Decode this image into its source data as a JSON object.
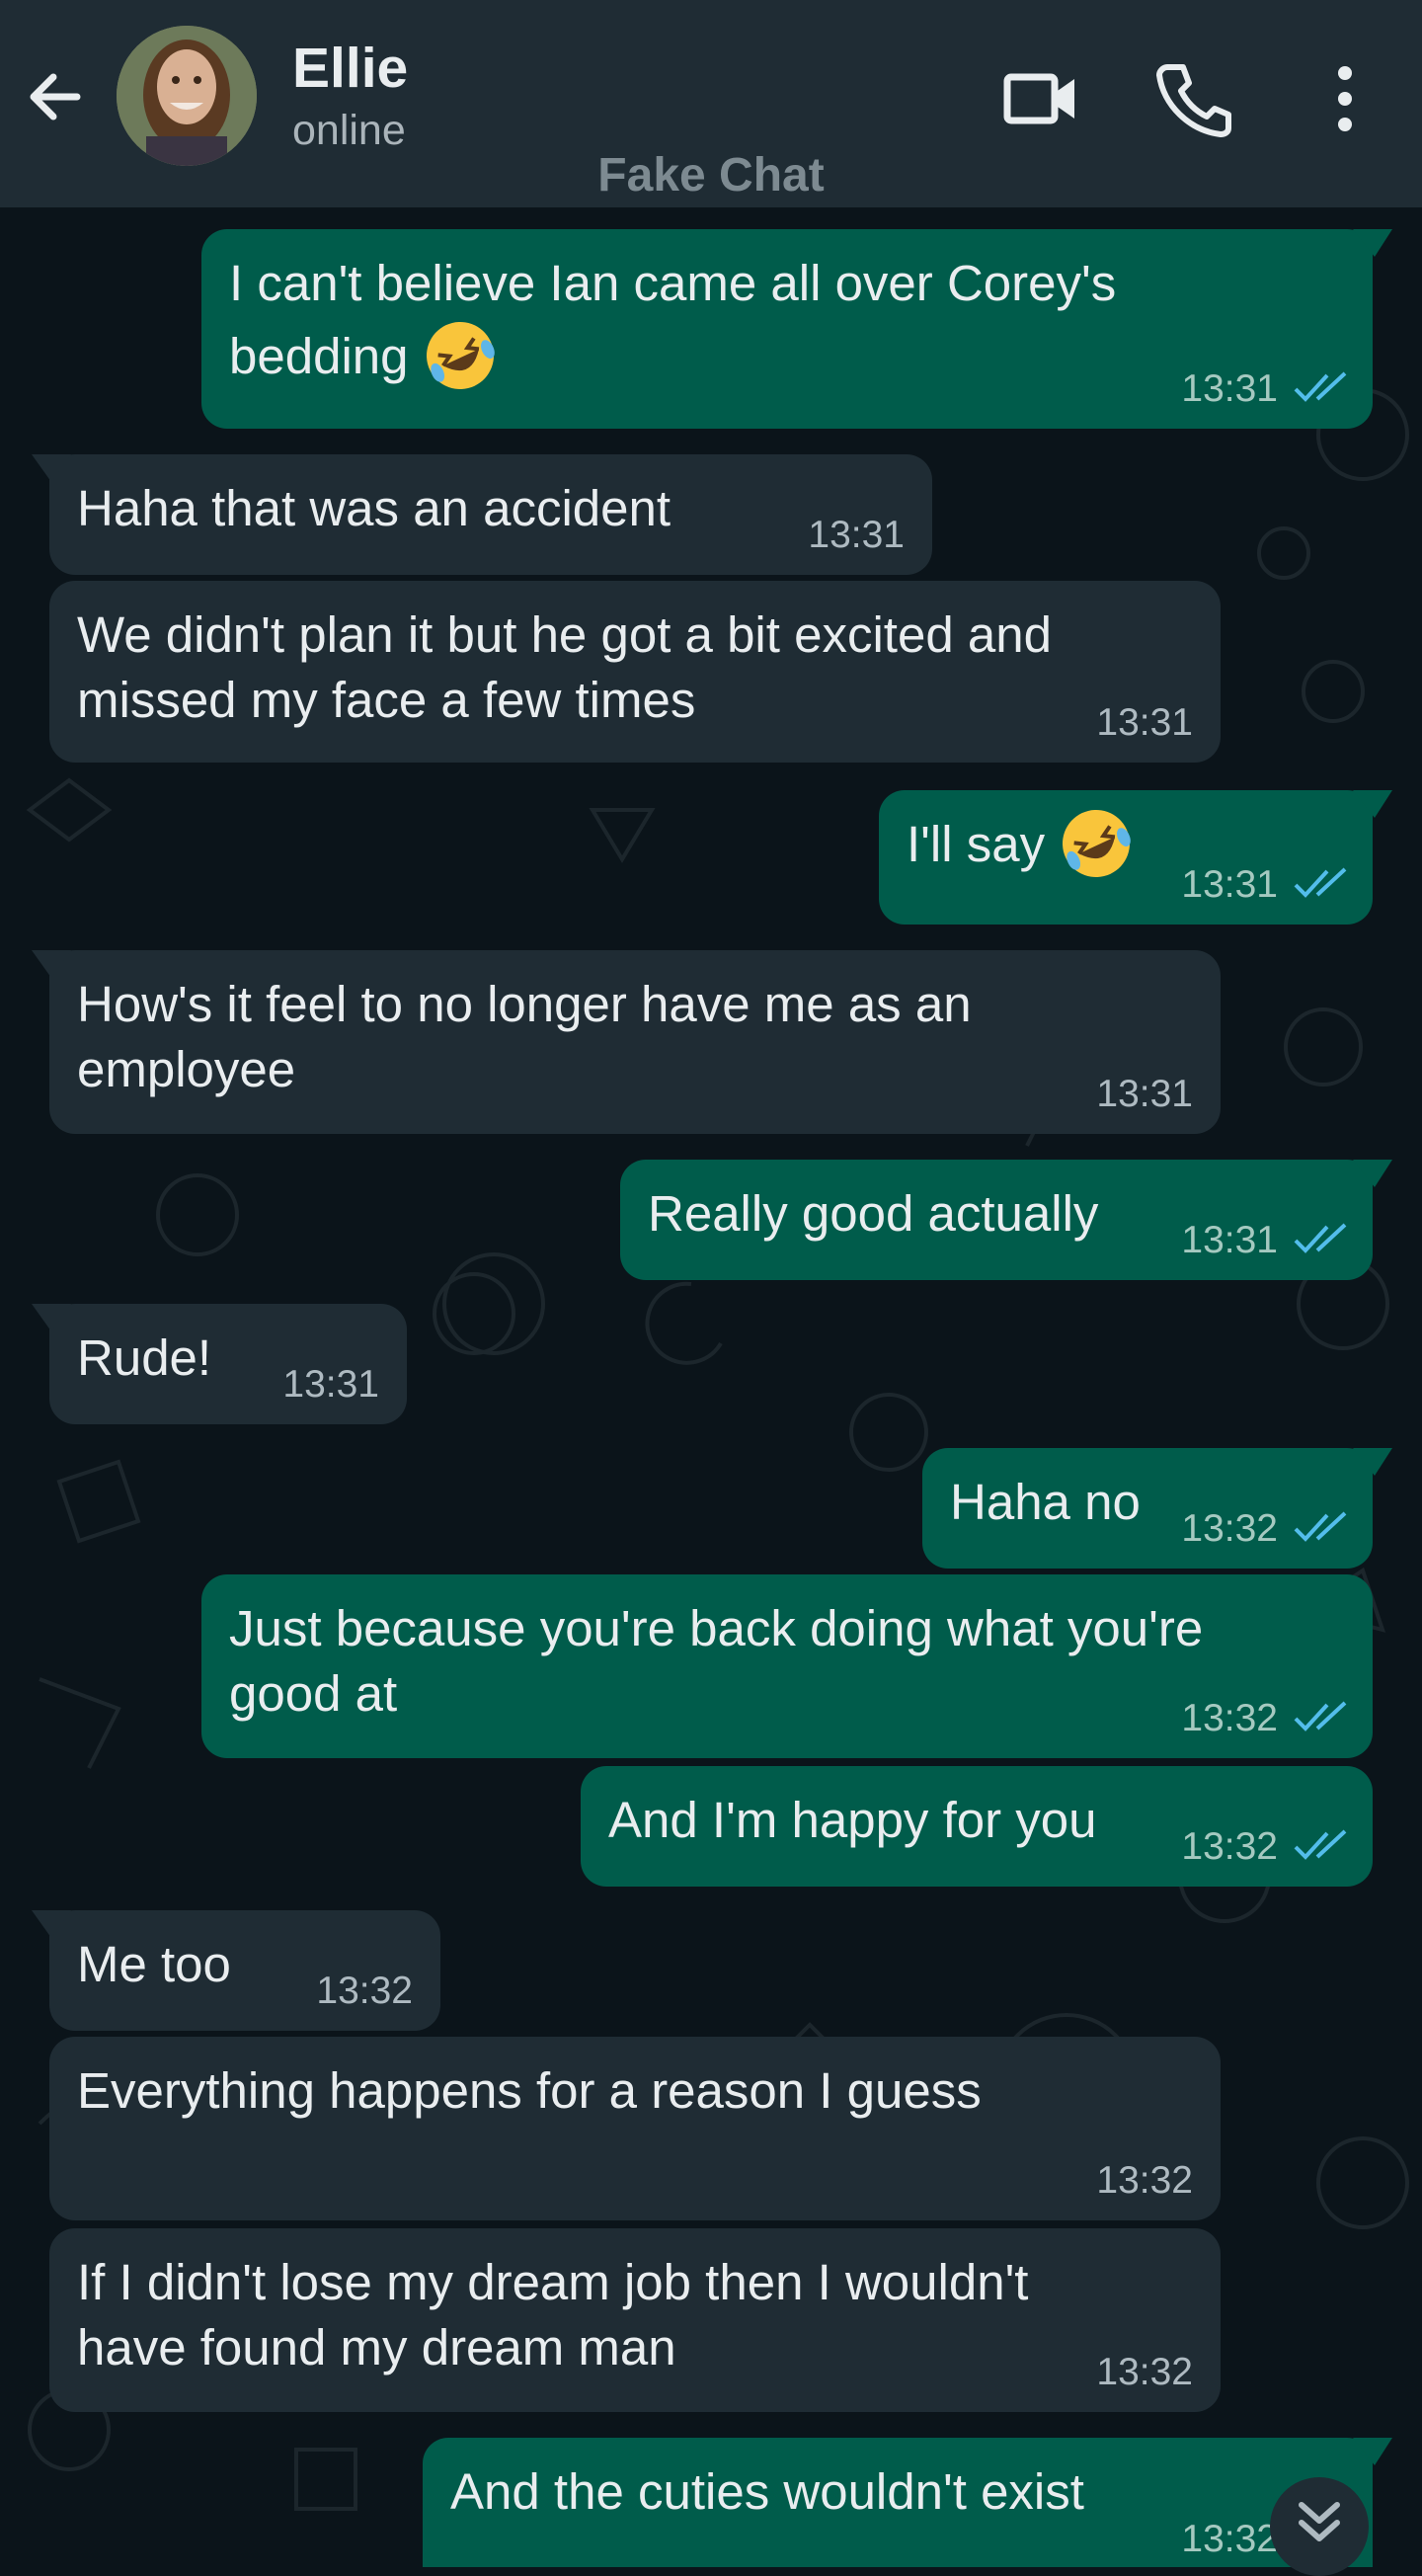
{
  "header": {
    "contact_name": "Ellie",
    "status": "online",
    "watermark": "Fake Chat",
    "icons": [
      "back-arrow-icon",
      "video-call-icon",
      "phone-icon",
      "more-options-icon"
    ]
  },
  "colors": {
    "background": "#0b141a",
    "header": "#1f2c34",
    "incoming_bubble": "#1f2c34",
    "outgoing_bubble": "#005c4b",
    "read_tick": "#53bdeb"
  },
  "messages": [
    {
      "dir": "out",
      "line1": "I can't believe Ian came all over Corey's",
      "line2": "bedding",
      "emoji": "rolling-on-floor-laughing-emoji",
      "time": "13:31",
      "status": "read"
    },
    {
      "dir": "in",
      "text": "Haha that was an accident",
      "time": "13:31"
    },
    {
      "dir": "in",
      "line1": "We didn't plan it but he got a bit excited and",
      "line2": "missed my face a few times",
      "time": "13:31"
    },
    {
      "dir": "out",
      "text": "I'll say",
      "emoji": "rolling-on-floor-laughing-emoji",
      "time": "13:31",
      "status": "read"
    },
    {
      "dir": "in",
      "line1": "How's it feel to no longer have me as an",
      "line2": "employee",
      "time": "13:31"
    },
    {
      "dir": "out",
      "text": "Really good actually",
      "time": "13:31",
      "status": "read"
    },
    {
      "dir": "in",
      "text": "Rude!",
      "time": "13:31"
    },
    {
      "dir": "out",
      "text": "Haha no",
      "time": "13:32",
      "status": "read"
    },
    {
      "dir": "out",
      "line1": "Just because you're back doing what you're",
      "line2": "good at",
      "time": "13:32",
      "status": "read"
    },
    {
      "dir": "out",
      "text": "And I'm happy for you",
      "time": "13:32",
      "status": "read"
    },
    {
      "dir": "in",
      "text": "Me too",
      "time": "13:32"
    },
    {
      "dir": "in",
      "text": "Everything happens for a reason I guess",
      "time": "13:32"
    },
    {
      "dir": "in",
      "line1": "If I didn't lose my dream job then I wouldn't",
      "line2": "have found my dream man",
      "time": "13:32"
    },
    {
      "dir": "out",
      "text": "And the cuties wouldn't exist",
      "time": "13:32",
      "status": "read"
    }
  ],
  "scroll_button": {
    "icon": "double-chevron-down-icon"
  }
}
